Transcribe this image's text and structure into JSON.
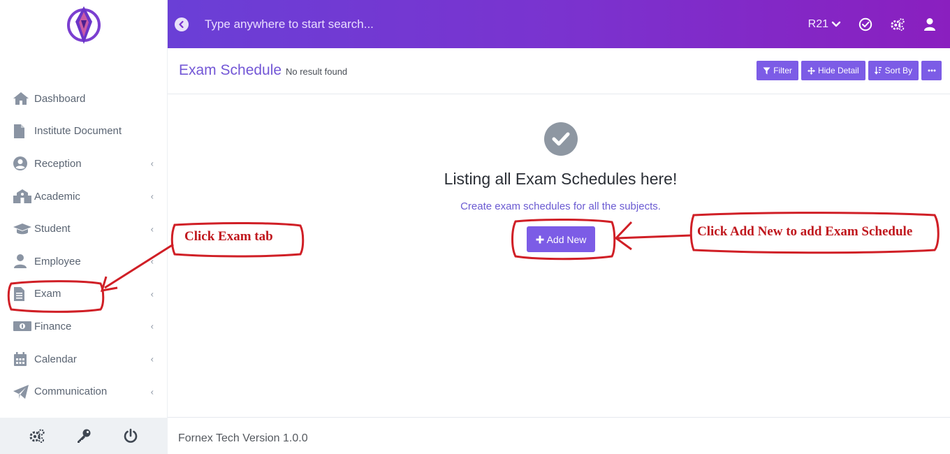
{
  "topbar": {
    "search_placeholder": "Type anywhere to start search...",
    "session": "R21"
  },
  "sidebar": {
    "items": [
      {
        "label": "Dashboard",
        "icon": "home-icon",
        "chevron": false
      },
      {
        "label": "Institute Document",
        "icon": "document-icon",
        "chevron": false
      },
      {
        "label": "Reception",
        "icon": "user-circle-icon",
        "chevron": true
      },
      {
        "label": "Academic",
        "icon": "school-icon",
        "chevron": true
      },
      {
        "label": "Student",
        "icon": "graduation-cap-icon",
        "chevron": true
      },
      {
        "label": "Employee",
        "icon": "employee-icon",
        "chevron": true
      },
      {
        "label": "Exam",
        "icon": "file-text-icon",
        "chevron": true
      },
      {
        "label": "Finance",
        "icon": "money-icon",
        "chevron": true
      },
      {
        "label": "Calendar",
        "icon": "calendar-icon",
        "chevron": true
      },
      {
        "label": "Communication",
        "icon": "paper-plane-icon",
        "chevron": true
      }
    ],
    "chevron_glyph": "‹"
  },
  "header": {
    "title": "Exam Schedule",
    "subtitle": "No result found",
    "filter_label": "Filter",
    "hide_detail_label": "Hide Detail",
    "sort_by_label": "Sort By"
  },
  "empty_state": {
    "title": "Listing all Exam Schedules here!",
    "subtitle": "Create exam schedules for all the subjects.",
    "add_new_label": "Add New"
  },
  "footer": {
    "version_text": "Fornex Tech Version 1.0.0"
  },
  "annotations": {
    "exam_tab": "Click Exam tab",
    "add_new": "Click Add New to add Exam  Schedule"
  },
  "colors": {
    "brand": "#7c5ce6",
    "annotation": "#c0181e"
  }
}
